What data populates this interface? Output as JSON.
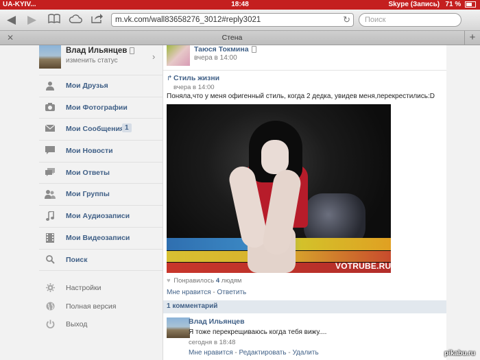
{
  "statusbar": {
    "carrier": "UA-KYIV...",
    "time": "18:48",
    "right": "Skype (Запись)",
    "battery": "71 %"
  },
  "browser": {
    "url": "m.vk.com/wall83658276_3012#reply3021",
    "search_placeholder": "Поиск",
    "tab_title": "Стена",
    "icons": {
      "back": "back-arrow-icon",
      "forward": "forward-arrow-icon",
      "bookmarks": "book-icon",
      "cloud": "cloud-icon",
      "share": "share-icon",
      "reload": "reload-icon",
      "close": "close-icon",
      "new_tab": "plus-icon"
    }
  },
  "sidebar": {
    "profile": {
      "name": "Влад Ильянцев",
      "status": "изменить статус"
    },
    "items": [
      {
        "label": "Мои Друзья",
        "icon": "person-icon"
      },
      {
        "label": "Мои Фотографии",
        "icon": "camera-icon"
      },
      {
        "label": "Мои Сообщения",
        "icon": "envelope-icon",
        "badge": "1"
      },
      {
        "label": "Мои Новости",
        "icon": "speech-bubble-icon"
      },
      {
        "label": "Мои Ответы",
        "icon": "chat-bubbles-icon"
      },
      {
        "label": "Мои Группы",
        "icon": "group-icon"
      },
      {
        "label": "Мои Аудиозаписи",
        "icon": "music-note-icon"
      },
      {
        "label": "Мои Видеозаписи",
        "icon": "film-icon"
      },
      {
        "label": "Поиск",
        "icon": "search-icon"
      }
    ],
    "secondary": [
      {
        "label": "Настройки",
        "icon": "gear-icon"
      },
      {
        "label": "Полная версия",
        "icon": "globe-icon"
      },
      {
        "label": "Выход",
        "icon": "power-icon"
      }
    ]
  },
  "post": {
    "author": "Таюся Токмина",
    "time": "вчера в 14:00",
    "repost": {
      "title": "Стиль жизни",
      "time": "вчера в 14:00"
    },
    "text": "Поняла,что у меня офигенный стиль, когда 2 дедка, увидев меня,перекрестились:D",
    "photo_watermark": "VOTRUBE.RU",
    "likes_prefix": "Понравилось",
    "likes_count": "4",
    "likes_suffix": "людям",
    "like_action": "Мне нравится",
    "reply_action": "Ответить",
    "separator": "-"
  },
  "comments": {
    "header": "1 комментарий",
    "items": [
      {
        "author": "Влад Ильянцев",
        "text": "Я тоже перекрещиваюсь когда тебя вижу....",
        "time": "сегодня в 18:48",
        "like_action": "Мне нравится",
        "edit_action": "Редактировать",
        "delete_action": "Удалить"
      }
    ]
  },
  "watermark": "pikabu.ru"
}
